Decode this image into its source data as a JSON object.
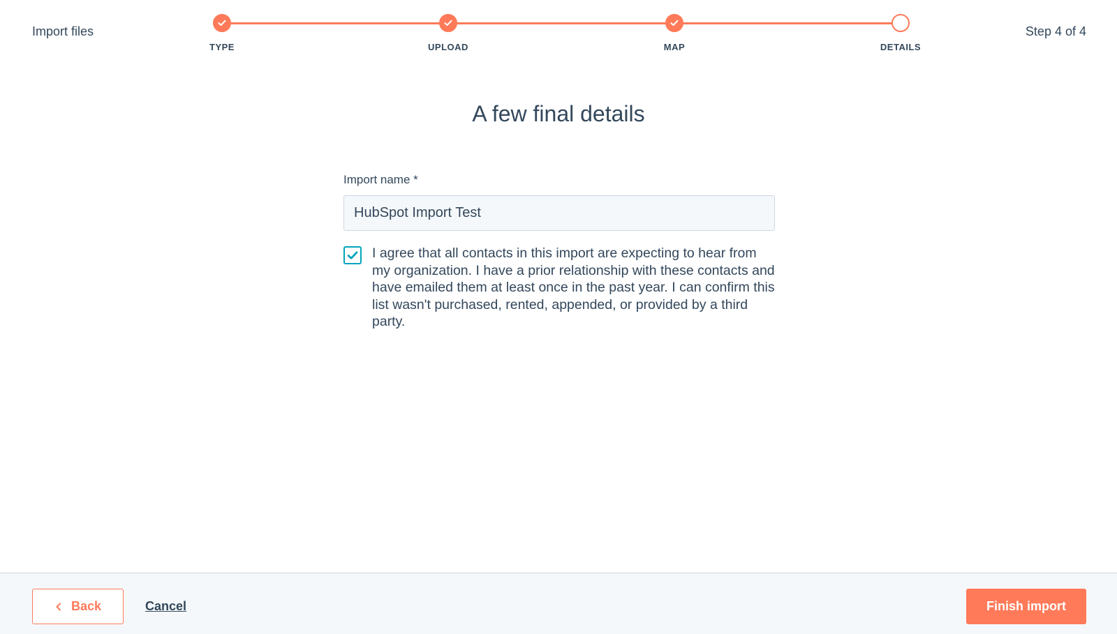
{
  "header": {
    "title": "Import files",
    "step_count": "Step 4 of 4",
    "steps": [
      {
        "label": "TYPE",
        "status": "complete"
      },
      {
        "label": "UPLOAD",
        "status": "complete"
      },
      {
        "label": "MAP",
        "status": "complete"
      },
      {
        "label": "DETAILS",
        "status": "current"
      }
    ]
  },
  "main": {
    "title": "A few final details",
    "import_name_label": "Import name *",
    "import_name_value": "HubSpot Import Test",
    "consent_checked": true,
    "consent_text": "I agree that all contacts in this import are expecting to hear from my organization. I have a prior relationship with these contacts and have emailed them at least once in the past year. I can confirm this list wasn't purchased, rented, appended, or provided by a third party."
  },
  "footer": {
    "back_label": "Back",
    "cancel_label": "Cancel",
    "finish_label": "Finish import"
  },
  "colors": {
    "accent": "#ff7a59",
    "checkbox": "#00a4bd",
    "text": "#33475b"
  },
  "icons": {
    "step_complete": "checkmark-icon",
    "step_current": "empty-circle-icon",
    "back": "chevron-left-icon",
    "checkbox": "checkmark-icon"
  }
}
